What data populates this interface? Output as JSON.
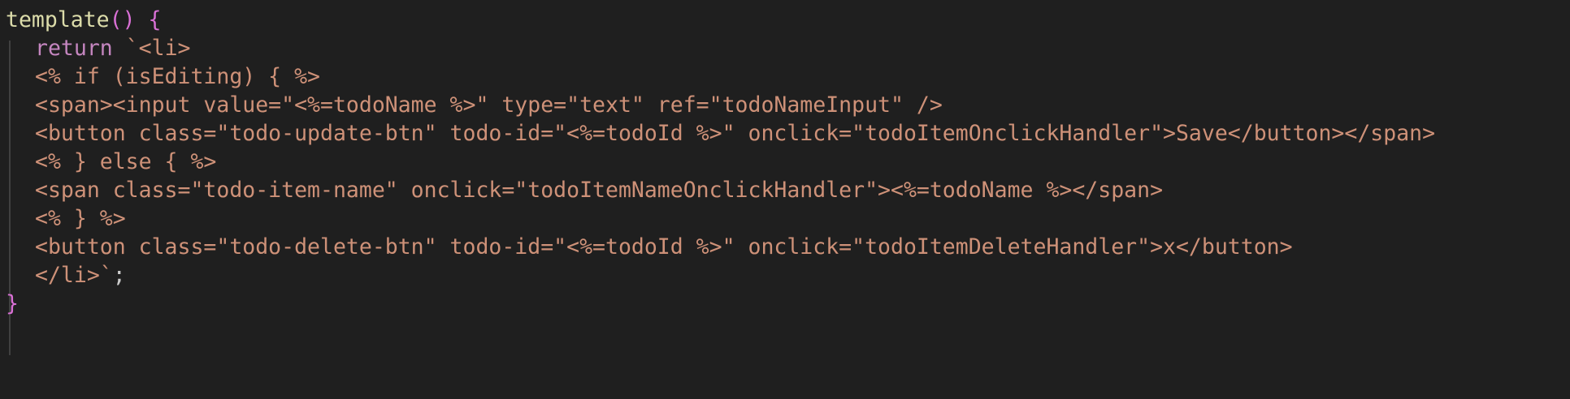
{
  "code": {
    "fn_name": "template",
    "open_parens": "()",
    "open_brace": "{",
    "return_keyword": "return",
    "template_literal_start": "`<li>",
    "lines": [
      "<% if (isEditing) { %>",
      "<span><input value=\"<%=todoName %>\" type=\"text\" ref=\"todoNameInput\" />",
      "<button class=\"todo-update-btn\" todo-id=\"<%=todoId %>\" onclick=\"todoItemOnclickHandler\">Save</button></span>",
      "<% } else { %>",
      "<span class=\"todo-item-name\" onclick=\"todoItemNameOnclickHandler\"><%=todoName %></span>",
      "<% } %>",
      "<button class=\"todo-delete-btn\" todo-id=\"<%=todoId %>\" onclick=\"todoItemDeleteHandler\">x</button>"
    ],
    "template_literal_end": "</li>`",
    "semicolon": ";",
    "close_brace": "}"
  }
}
